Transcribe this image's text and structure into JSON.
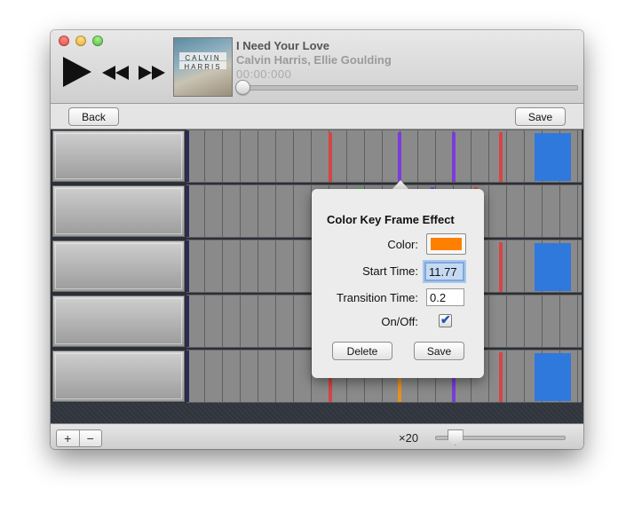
{
  "player": {
    "song_title": "I Need Your Love",
    "artist": "Calvin Harris, Ellie Goulding",
    "time": "00:00:000",
    "progress": 0,
    "album_art_text_1": "CALVIN",
    "album_art_text_2": "HARRIS"
  },
  "toolbar": {
    "back_label": "Back",
    "save_label": "Save"
  },
  "timeline": {
    "rows": [
      {
        "keyframes": [
          {
            "time": 7.9,
            "color": "#d64545"
          },
          {
            "time": 11.77,
            "color": "#7a3ddb"
          },
          {
            "time": 14.8,
            "color": "#7a3ddb"
          },
          {
            "time": 17.4,
            "color": "#d64545"
          }
        ],
        "blocks": [
          {
            "start": 19.4,
            "end": 21.4,
            "color": "#2f79dc"
          }
        ]
      },
      {
        "keyframes": [
          {
            "time": 9.6,
            "color": "#3fbf3f"
          },
          {
            "time": 13.6,
            "color": "#7a3ddb"
          },
          {
            "time": 16.0,
            "color": "#d64545"
          }
        ],
        "blocks": []
      },
      {
        "keyframes": [
          {
            "time": 17.4,
            "color": "#d64545"
          }
        ],
        "blocks": [
          {
            "start": 19.4,
            "end": 21.4,
            "color": "#2f79dc"
          }
        ]
      },
      {
        "keyframes": [],
        "blocks": []
      },
      {
        "keyframes": [
          {
            "time": 7.9,
            "color": "#d64545"
          },
          {
            "time": 11.77,
            "color": "#e8901f"
          },
          {
            "time": 14.8,
            "color": "#7a3ddb"
          },
          {
            "time": 17.4,
            "color": "#d64545"
          }
        ],
        "blocks": [
          {
            "start": 19.4,
            "end": 21.4,
            "color": "#2f79dc"
          }
        ]
      }
    ],
    "visible_duration": 22
  },
  "status": {
    "add_label": "+",
    "remove_label": "−",
    "zoom_label": "×20",
    "zoom_level": 0.15
  },
  "popover": {
    "title": "Color Key Frame Effect",
    "color_label": "Color:",
    "color_value": "#ff8000",
    "start_time_label": "Start Time:",
    "start_time_value": "11.77",
    "transition_time_label": "Transition Time:",
    "transition_time_value": "0.2",
    "on_off_label": "On/Off:",
    "on_off_checked": true,
    "delete_label": "Delete",
    "save_label": "Save"
  },
  "icons": {
    "play": "play-icon",
    "rewind": "rewind-icon",
    "fast_forward": "fast-forward-icon"
  }
}
